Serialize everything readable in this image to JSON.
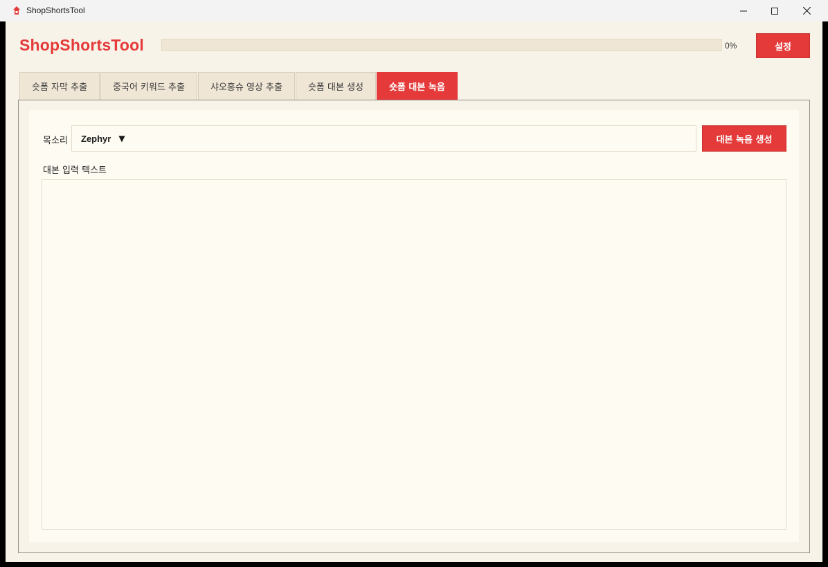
{
  "window": {
    "title": "ShopShortsTool",
    "minimize_icon": "minimize-icon",
    "maximize_icon": "maximize-icon",
    "close_icon": "close-icon"
  },
  "header": {
    "brand": "ShopShortsTool",
    "progress_percent": 0,
    "progress_text": "0%",
    "settings_label": "설정"
  },
  "tabs": [
    {
      "label": "숏폼 자막 추출",
      "active": false
    },
    {
      "label": "중국어 키워드 추출",
      "active": false
    },
    {
      "label": "샤오홍슈 영상 추출",
      "active": false
    },
    {
      "label": "숏폼 대본 생성",
      "active": false
    },
    {
      "label": "숏폼 대본 녹음",
      "active": true
    }
  ],
  "recording": {
    "voice_label": "목소리",
    "voice_value": "Zephyr",
    "dropdown_icon": "▼",
    "record_button": "대본 녹음 생성",
    "text_label": "대본 입력 텍스트",
    "text_value": ""
  },
  "colors": {
    "accent": "#e43a3a",
    "background": "#f8f3e9",
    "panel": "#fefbf3",
    "tab_inactive": "#efe6d6"
  }
}
